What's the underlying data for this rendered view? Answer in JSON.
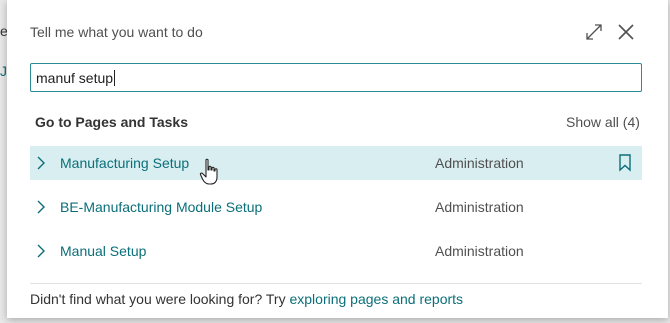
{
  "backdrop": {
    "frag1": "e",
    "frag2": "J"
  },
  "dialog": {
    "title": "Tell me what you want to do",
    "expand_icon": "expand-icon",
    "close_icon": "close-icon"
  },
  "search": {
    "value": "manuf setup"
  },
  "section": {
    "header": "Go to Pages and Tasks",
    "show_all": "Show all (4)"
  },
  "results": [
    {
      "name": "Manufacturing Setup",
      "category": "Administration",
      "highlighted": true,
      "bookmark": true
    },
    {
      "name": "BE-Manufacturing Module Setup",
      "category": "Administration",
      "highlighted": false,
      "bookmark": false
    },
    {
      "name": "Manual Setup",
      "category": "Administration",
      "highlighted": false,
      "bookmark": false
    }
  ],
  "footer": {
    "prefix": "Didn't find what you were looking for? Try ",
    "link": "exploring pages and reports"
  },
  "colors": {
    "accent": "#0b6f79",
    "highlight": "#d8eef0",
    "border": "#2b8c95"
  }
}
